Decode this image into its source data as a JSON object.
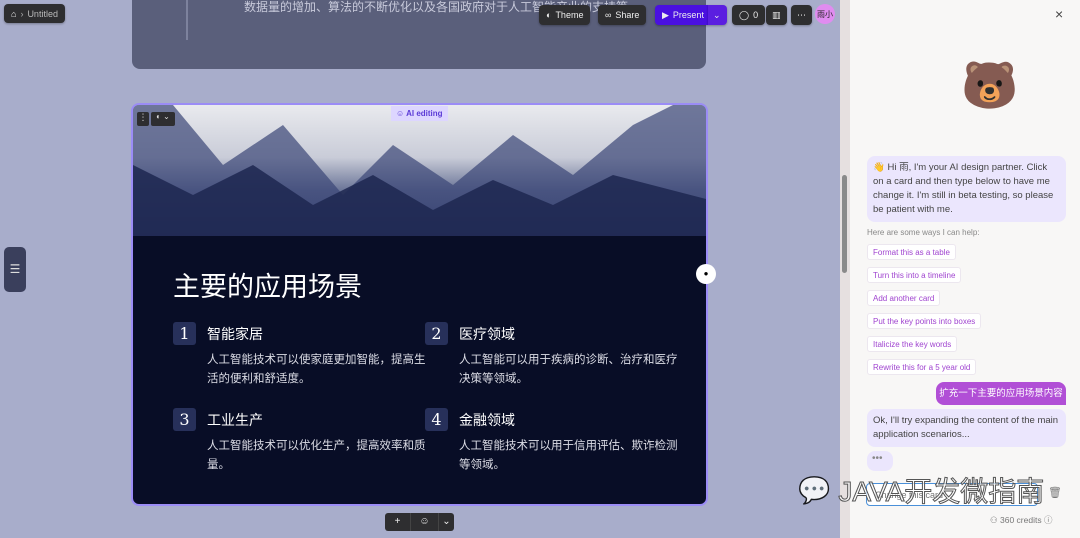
{
  "topbar": {
    "breadcrumb": "Untitled",
    "theme": "Theme",
    "share": "Share",
    "present": "Present",
    "comments": "0",
    "avatar": "雨小"
  },
  "prev_card_text": "数据量的增加、算法的不断优化以及各国政府对于人工智能产业的支持等",
  "card": {
    "ai_badge": "AI editing",
    "title": "主要的应用场景",
    "items": [
      {
        "num": "1",
        "title": "智能家居",
        "desc": "人工智能技术可以使家庭更加智能，提高生活的便利和舒适度。"
      },
      {
        "num": "2",
        "title": "医疗领域",
        "desc": "人工智能可以用于疾病的诊断、治疗和医疗决策等领域。"
      },
      {
        "num": "3",
        "title": "工业生产",
        "desc": "人工智能技术可以优化生产，提高效率和质量。"
      },
      {
        "num": "4",
        "title": "金融领域",
        "desc": "人工智能技术可以用于信用评估、欺诈检测等领域。"
      }
    ]
  },
  "panel": {
    "greeting": "👋 Hi 雨, I'm your AI design partner. Click on a card and then type below to have me change it. I'm still in beta testing, so please be patient with me.",
    "help_label": "Here are some ways I can help:",
    "suggestions": [
      "Format this as a table",
      "Turn this into a timeline",
      "Add another card",
      "Put the key points into boxes",
      "Italicize the key words",
      "Rewrite this for a 5 year old"
    ],
    "user_message": "扩充一下主要的应用场景内容",
    "ai_reply": "Ok, I'll try expanding the content of the main application scenarios...",
    "input_placeholder": "Change this card",
    "credits": "360 credits"
  },
  "watermark": "JAVA开发微指南",
  "colors": {
    "accent": "#5b1ee0",
    "chip_text": "#a044d0",
    "user_bubble": "#b14fd6",
    "ai_bubble": "#ebe6fd"
  }
}
